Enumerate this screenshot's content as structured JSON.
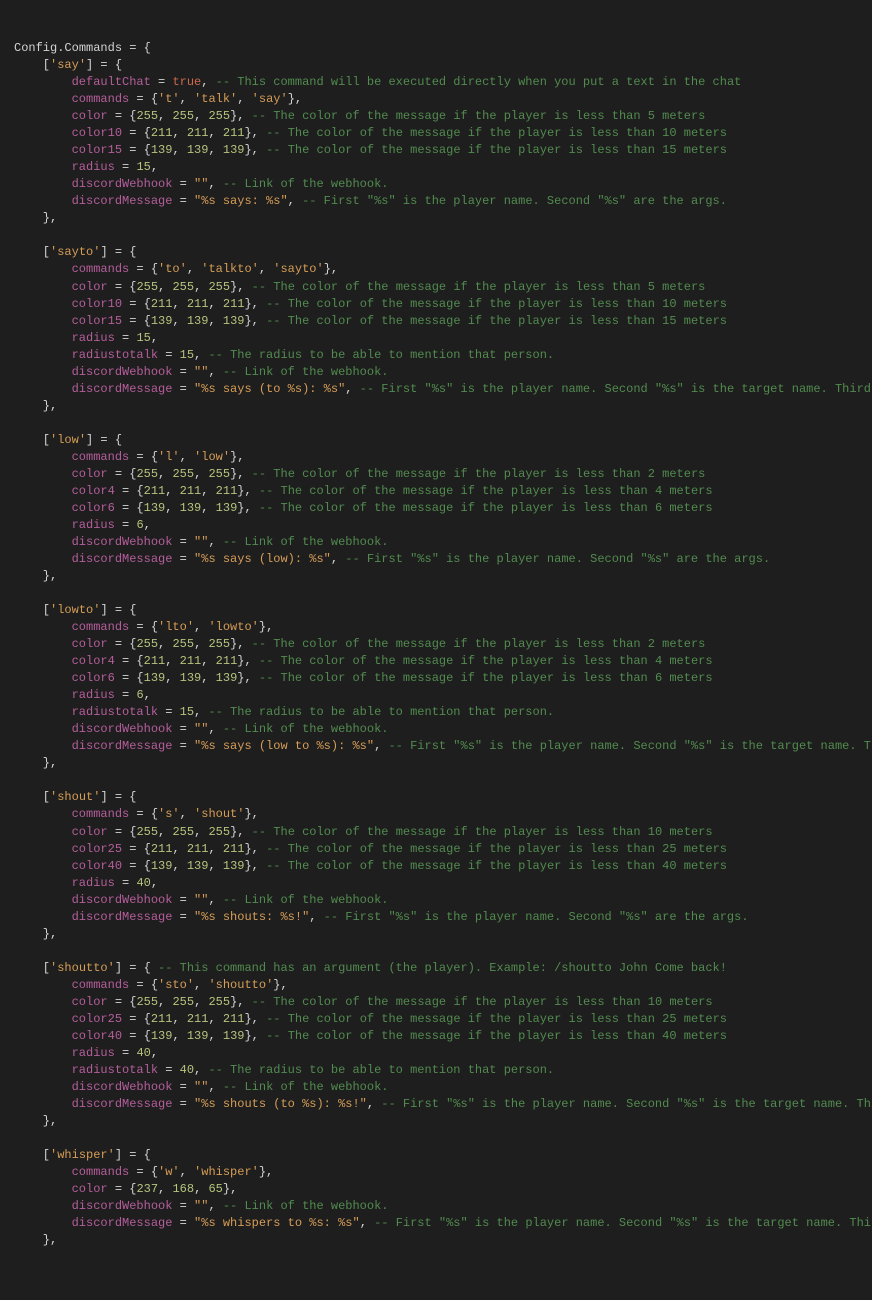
{
  "l1_a": "Config",
  "l1_b": ".",
  "l1_c": "Commands",
  "l1_d": " = {",
  "say_open": "    [",
  "say_key": "'say'",
  "say_rest": "] = {",
  "say_defchat_i": "        ",
  "say_defchat_p": "defaultChat",
  "say_defchat_eq": " = ",
  "say_defchat_v": "true",
  "say_defchat_c": ",",
  "say_defchat_cm": " -- This command will be executed directly when you put a text in the chat",
  "say_cmds_i": "        ",
  "say_cmds_p": "commands",
  "say_cmds_eq": " = {",
  "say_cmds_v1": "'t'",
  "say_cmds_s1": ", ",
  "say_cmds_v2": "'talk'",
  "say_cmds_s2": ", ",
  "say_cmds_v3": "'say'",
  "say_cmds_end": "},",
  "say_col_i": "        ",
  "say_col_p": "color",
  "say_col_eq": " = {",
  "say_col_n1": "255",
  "say_col_s1": ", ",
  "say_col_n2": "255",
  "say_col_s2": ", ",
  "say_col_n3": "255",
  "say_col_end": "},",
  "say_col_cm": " -- The color of the message if the player is less than 5 meters",
  "say_c10_i": "        ",
  "say_c10_p": "color10",
  "say_c10_eq": " = {",
  "say_c10_n1": "211",
  "say_c10_s1": ", ",
  "say_c10_n2": "211",
  "say_c10_s2": ", ",
  "say_c10_n3": "211",
  "say_c10_end": "},",
  "say_c10_cm": " -- The color of the message if the player is less than 10 meters",
  "say_c15_i": "        ",
  "say_c15_p": "color15",
  "say_c15_eq": " = {",
  "say_c15_n1": "139",
  "say_c15_s1": ", ",
  "say_c15_n2": "139",
  "say_c15_s2": ", ",
  "say_c15_n3": "139",
  "say_c15_end": "},",
  "say_c15_cm": " -- The color of the message if the player is less than 15 meters",
  "say_rad_i": "        ",
  "say_rad_p": "radius",
  "say_rad_eq": " = ",
  "say_rad_n": "15",
  "say_rad_end": ",",
  "say_dw_i": "        ",
  "say_dw_p": "discordWebhook",
  "say_dw_eq": " = ",
  "say_dw_v": "\"\"",
  "say_dw_end": ",",
  "say_dw_cm": " -- Link of the webhook.",
  "say_dm_i": "        ",
  "say_dm_p": "discordMessage",
  "say_dm_eq": " = ",
  "say_dm_v": "\"%s says: %s\"",
  "say_dm_end": ",",
  "say_dm_cm": " -- First \"%s\" is the player name. Second \"%s\" are the args.",
  "say_close": "    },",
  "st_open": "    [",
  "st_key": "'sayto'",
  "st_rest": "] = {",
  "st_cmds_i": "        ",
  "st_cmds_p": "commands",
  "st_cmds_eq": " = {",
  "st_cmds_v1": "'to'",
  "st_cmds_s1": ", ",
  "st_cmds_v2": "'talkto'",
  "st_cmds_s2": ", ",
  "st_cmds_v3": "'sayto'",
  "st_cmds_end": "},",
  "st_col_i": "        ",
  "st_col_p": "color",
  "st_col_eq": " = {",
  "st_col_n1": "255",
  "st_col_s1": ", ",
  "st_col_n2": "255",
  "st_col_s2": ", ",
  "st_col_n3": "255",
  "st_col_end": "},",
  "st_col_cm": " -- The color of the message if the player is less than 5 meters",
  "st_c10_i": "        ",
  "st_c10_p": "color10",
  "st_c10_eq": " = {",
  "st_c10_n1": "211",
  "st_c10_s1": ", ",
  "st_c10_n2": "211",
  "st_c10_s2": ", ",
  "st_c10_n3": "211",
  "st_c10_end": "},",
  "st_c10_cm": " -- The color of the message if the player is less than 10 meters",
  "st_c15_i": "        ",
  "st_c15_p": "color15",
  "st_c15_eq": " = {",
  "st_c15_n1": "139",
  "st_c15_s1": ", ",
  "st_c15_n2": "139",
  "st_c15_s2": ", ",
  "st_c15_n3": "139",
  "st_c15_end": "},",
  "st_c15_cm": " -- The color of the message if the player is less than 15 meters",
  "st_rad_i": "        ",
  "st_rad_p": "radius",
  "st_rad_eq": " = ",
  "st_rad_n": "15",
  "st_rad_end": ",",
  "st_rtt_i": "        ",
  "st_rtt_p": "radiustotalk",
  "st_rtt_eq": " = ",
  "st_rtt_n": "15",
  "st_rtt_end": ",",
  "st_rtt_cm": " -- The radius to be able to mention that person.",
  "st_dw_i": "        ",
  "st_dw_p": "discordWebhook",
  "st_dw_eq": " = ",
  "st_dw_v": "\"\"",
  "st_dw_end": ",",
  "st_dw_cm": " -- Link of the webhook.",
  "st_dm_i": "        ",
  "st_dm_p": "discordMessage",
  "st_dm_eq": " = ",
  "st_dm_v": "\"%s says (to %s): %s\"",
  "st_dm_end": ",",
  "st_dm_cm": " -- First \"%s\" is the player name. Second \"%s\" is the target name. Third \"%s\" are the args.",
  "st_close": "    },",
  "lw_open": "    [",
  "lw_key": "'low'",
  "lw_rest": "] = {",
  "lw_cmds_i": "        ",
  "lw_cmds_p": "commands",
  "lw_cmds_eq": " = {",
  "lw_cmds_v1": "'l'",
  "lw_cmds_s1": ", ",
  "lw_cmds_v2": "'low'",
  "lw_cmds_end": "},",
  "lw_col_i": "        ",
  "lw_col_p": "color",
  "lw_col_eq": " = {",
  "lw_col_n1": "255",
  "lw_col_s1": ", ",
  "lw_col_n2": "255",
  "lw_col_s2": ", ",
  "lw_col_n3": "255",
  "lw_col_end": "},",
  "lw_col_cm": " -- The color of the message if the player is less than 2 meters",
  "lw_c4_i": "        ",
  "lw_c4_p": "color4",
  "lw_c4_eq": " = {",
  "lw_c4_n1": "211",
  "lw_c4_s1": ", ",
  "lw_c4_n2": "211",
  "lw_c4_s2": ", ",
  "lw_c4_n3": "211",
  "lw_c4_end": "},",
  "lw_c4_cm": " -- The color of the message if the player is less than 4 meters",
  "lw_c6_i": "        ",
  "lw_c6_p": "color6",
  "lw_c6_eq": " = {",
  "lw_c6_n1": "139",
  "lw_c6_s1": ", ",
  "lw_c6_n2": "139",
  "lw_c6_s2": ", ",
  "lw_c6_n3": "139",
  "lw_c6_end": "},",
  "lw_c6_cm": " -- The color of the message if the player is less than 6 meters",
  "lw_rad_i": "        ",
  "lw_rad_p": "radius",
  "lw_rad_eq": " = ",
  "lw_rad_n": "6",
  "lw_rad_end": ",",
  "lw_dw_i": "        ",
  "lw_dw_p": "discordWebhook",
  "lw_dw_eq": " = ",
  "lw_dw_v": "\"\"",
  "lw_dw_end": ",",
  "lw_dw_cm": " -- Link of the webhook.",
  "lw_dm_i": "        ",
  "lw_dm_p": "discordMessage",
  "lw_dm_eq": " = ",
  "lw_dm_v": "\"%s says (low): %s\"",
  "lw_dm_end": ",",
  "lw_dm_cm": " -- First \"%s\" is the player name. Second \"%s\" are the args.",
  "lw_close": "    },",
  "lt_open": "    [",
  "lt_key": "'lowto'",
  "lt_rest": "] = {",
  "lt_cmds_i": "        ",
  "lt_cmds_p": "commands",
  "lt_cmds_eq": " = {",
  "lt_cmds_v1": "'lto'",
  "lt_cmds_s1": ", ",
  "lt_cmds_v2": "'lowto'",
  "lt_cmds_end": "},",
  "lt_col_i": "        ",
  "lt_col_p": "color",
  "lt_col_eq": " = {",
  "lt_col_n1": "255",
  "lt_col_s1": ", ",
  "lt_col_n2": "255",
  "lt_col_s2": ", ",
  "lt_col_n3": "255",
  "lt_col_end": "},",
  "lt_col_cm": " -- The color of the message if the player is less than 2 meters",
  "lt_c4_i": "        ",
  "lt_c4_p": "color4",
  "lt_c4_eq": " = {",
  "lt_c4_n1": "211",
  "lt_c4_s1": ", ",
  "lt_c4_n2": "211",
  "lt_c4_s2": ", ",
  "lt_c4_n3": "211",
  "lt_c4_end": "},",
  "lt_c4_cm": " -- The color of the message if the player is less than 4 meters",
  "lt_c6_i": "        ",
  "lt_c6_p": "color6",
  "lt_c6_eq": " = {",
  "lt_c6_n1": "139",
  "lt_c6_s1": ", ",
  "lt_c6_n2": "139",
  "lt_c6_s2": ", ",
  "lt_c6_n3": "139",
  "lt_c6_end": "},",
  "lt_c6_cm": " -- The color of the message if the player is less than 6 meters",
  "lt_rad_i": "        ",
  "lt_rad_p": "radius",
  "lt_rad_eq": " = ",
  "lt_rad_n": "6",
  "lt_rad_end": ",",
  "lt_rtt_i": "        ",
  "lt_rtt_p": "radiustotalk",
  "lt_rtt_eq": " = ",
  "lt_rtt_n": "15",
  "lt_rtt_end": ",",
  "lt_rtt_cm": " -- The radius to be able to mention that person.",
  "lt_dw_i": "        ",
  "lt_dw_p": "discordWebhook",
  "lt_dw_eq": " = ",
  "lt_dw_v": "\"\"",
  "lt_dw_end": ",",
  "lt_dw_cm": " -- Link of the webhook.",
  "lt_dm_i": "        ",
  "lt_dm_p": "discordMessage",
  "lt_dm_eq": " = ",
  "lt_dm_v": "\"%s says (low to %s): %s\"",
  "lt_dm_end": ",",
  "lt_dm_cm": " -- First \"%s\" is the player name. Second \"%s\" is the target name. Third \"%s\" are the args.",
  "lt_close": "    },",
  "sh_open": "    [",
  "sh_key": "'shout'",
  "sh_rest": "] = {",
  "sh_cmds_i": "        ",
  "sh_cmds_p": "commands",
  "sh_cmds_eq": " = {",
  "sh_cmds_v1": "'s'",
  "sh_cmds_s1": ", ",
  "sh_cmds_v2": "'shout'",
  "sh_cmds_end": "},",
  "sh_col_i": "        ",
  "sh_col_p": "color",
  "sh_col_eq": " = {",
  "sh_col_n1": "255",
  "sh_col_s1": ", ",
  "sh_col_n2": "255",
  "sh_col_s2": ", ",
  "sh_col_n3": "255",
  "sh_col_end": "},",
  "sh_col_cm": " -- The color of the message if the player is less than 10 meters",
  "sh_c25_i": "        ",
  "sh_c25_p": "color25",
  "sh_c25_eq": " = {",
  "sh_c25_n1": "211",
  "sh_c25_s1": ", ",
  "sh_c25_n2": "211",
  "sh_c25_s2": ", ",
  "sh_c25_n3": "211",
  "sh_c25_end": "},",
  "sh_c25_cm": " -- The color of the message if the player is less than 25 meters",
  "sh_c40_i": "        ",
  "sh_c40_p": "color40",
  "sh_c40_eq": " = {",
  "sh_c40_n1": "139",
  "sh_c40_s1": ", ",
  "sh_c40_n2": "139",
  "sh_c40_s2": ", ",
  "sh_c40_n3": "139",
  "sh_c40_end": "},",
  "sh_c40_cm": " -- The color of the message if the player is less than 40 meters",
  "sh_rad_i": "        ",
  "sh_rad_p": "radius",
  "sh_rad_eq": " = ",
  "sh_rad_n": "40",
  "sh_rad_end": ",",
  "sh_dw_i": "        ",
  "sh_dw_p": "discordWebhook",
  "sh_dw_eq": " = ",
  "sh_dw_v": "\"\"",
  "sh_dw_end": ",",
  "sh_dw_cm": " -- Link of the webhook.",
  "sh_dm_i": "        ",
  "sh_dm_p": "discordMessage",
  "sh_dm_eq": " = ",
  "sh_dm_v": "\"%s shouts: %s!\"",
  "sh_dm_end": ",",
  "sh_dm_cm": " -- First \"%s\" is the player name. Second \"%s\" are the args.",
  "sh_close": "    },",
  "so_open": "    [",
  "so_key": "'shoutto'",
  "so_rest": "] = {",
  "so_hcm": " -- This command has an argument (the player). Example: /shoutto John Come back!",
  "so_cmds_i": "        ",
  "so_cmds_p": "commands",
  "so_cmds_eq": " = {",
  "so_cmds_v1": "'sto'",
  "so_cmds_s1": ", ",
  "so_cmds_v2": "'shoutto'",
  "so_cmds_end": "},",
  "so_col_i": "        ",
  "so_col_p": "color",
  "so_col_eq": " = {",
  "so_col_n1": "255",
  "so_col_s1": ", ",
  "so_col_n2": "255",
  "so_col_s2": ", ",
  "so_col_n3": "255",
  "so_col_end": "},",
  "so_col_cm": " -- The color of the message if the player is less than 10 meters",
  "so_c25_i": "        ",
  "so_c25_p": "color25",
  "so_c25_eq": " = {",
  "so_c25_n1": "211",
  "so_c25_s1": ", ",
  "so_c25_n2": "211",
  "so_c25_s2": ", ",
  "so_c25_n3": "211",
  "so_c25_end": "},",
  "so_c25_cm": " -- The color of the message if the player is less than 25 meters",
  "so_c40_i": "        ",
  "so_c40_p": "color40",
  "so_c40_eq": " = {",
  "so_c40_n1": "139",
  "so_c40_s1": ", ",
  "so_c40_n2": "139",
  "so_c40_s2": ", ",
  "so_c40_n3": "139",
  "so_c40_end": "},",
  "so_c40_cm": " -- The color of the message if the player is less than 40 meters",
  "so_rad_i": "        ",
  "so_rad_p": "radius",
  "so_rad_eq": " = ",
  "so_rad_n": "40",
  "so_rad_end": ",",
  "so_rtt_i": "        ",
  "so_rtt_p": "radiustotalk",
  "so_rtt_eq": " = ",
  "so_rtt_n": "40",
  "so_rtt_end": ",",
  "so_rtt_cm": " -- The radius to be able to mention that person.",
  "so_dw_i": "        ",
  "so_dw_p": "discordWebhook",
  "so_dw_eq": " = ",
  "so_dw_v": "\"\"",
  "so_dw_end": ",",
  "so_dw_cm": " -- Link of the webhook.",
  "so_dm_i": "        ",
  "so_dm_p": "discordMessage",
  "so_dm_eq": " = ",
  "so_dm_v": "\"%s shouts (to %s): %s!\"",
  "so_dm_end": ",",
  "so_dm_cm": " -- First \"%s\" is the player name. Second \"%s\" is the target name. Third \"%s\" are the args.",
  "so_close": "    },",
  "wh_open": "    [",
  "wh_key": "'whisper'",
  "wh_rest": "] = {",
  "wh_cmds_i": "        ",
  "wh_cmds_p": "commands",
  "wh_cmds_eq": " = {",
  "wh_cmds_v1": "'w'",
  "wh_cmds_s1": ", ",
  "wh_cmds_v2": "'whisper'",
  "wh_cmds_end": "},",
  "wh_col_i": "        ",
  "wh_col_p": "color",
  "wh_col_eq": " = {",
  "wh_col_n1": "237",
  "wh_col_s1": ", ",
  "wh_col_n2": "168",
  "wh_col_s2": ", ",
  "wh_col_n3": "65",
  "wh_col_end": "},",
  "wh_dw_i": "        ",
  "wh_dw_p": "discordWebhook",
  "wh_dw_eq": " = ",
  "wh_dw_v": "\"\"",
  "wh_dw_end": ",",
  "wh_dw_cm": " -- Link of the webhook.",
  "wh_dm_i": "        ",
  "wh_dm_p": "discordMessage",
  "wh_dm_eq": " = ",
  "wh_dm_v": "\"%s whispers to %s: %s\"",
  "wh_dm_end": ",",
  "wh_dm_cm": " -- First \"%s\" is the player name. Second \"%s\" is the target name. Third \"%s\" are the args.",
  "wh_close": "    },"
}
